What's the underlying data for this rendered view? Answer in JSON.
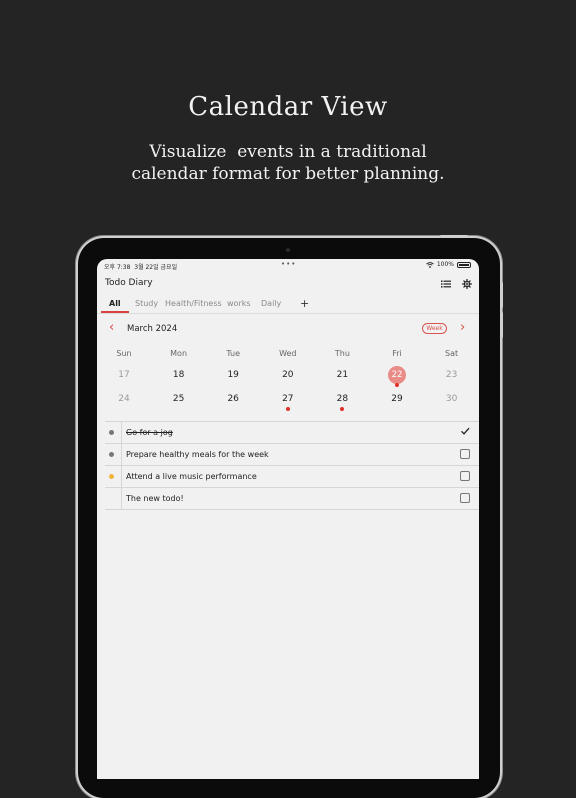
{
  "promo": {
    "title": "Calendar View",
    "subtitle_line1": "Visualize  events in a traditional",
    "subtitle_line2": "calendar format for better planning."
  },
  "status_bar": {
    "time": "오후 7:38",
    "date": "3월 22일 금요일",
    "dots": "•••",
    "battery": "100%"
  },
  "app": {
    "title": "Todo Diary",
    "list_icon": "list-icon",
    "settings_icon": "gear-icon"
  },
  "tabs": [
    {
      "label": "All",
      "active": true
    },
    {
      "label": "Study",
      "active": false
    },
    {
      "label": "Health/Fitness",
      "active": false
    },
    {
      "label": "works",
      "active": false
    },
    {
      "label": "Daily",
      "active": false
    }
  ],
  "tab_add": "+",
  "calendar": {
    "month_label": "March 2024",
    "view_toggle": "Week",
    "prev_icon": "‹",
    "next_icon": "›",
    "weekdays": [
      "Sun",
      "Mon",
      "Tue",
      "Wed",
      "Thu",
      "Fri",
      "Sat"
    ],
    "week1": [
      "17",
      "18",
      "19",
      "20",
      "21",
      "22",
      "23"
    ],
    "week2": [
      "24",
      "25",
      "26",
      "27",
      "28",
      "29",
      "30"
    ],
    "selected_day": "22",
    "days_with_events": [
      "22",
      "27",
      "28"
    ],
    "accent_color": "#d9423c",
    "selected_color": "#e98b86"
  },
  "todos": [
    {
      "text": "Go for a jog",
      "done": true,
      "bullet_color": "#777777"
    },
    {
      "text": "Prepare healthy meals for the week",
      "done": false,
      "bullet_color": "#777777"
    },
    {
      "text": "Attend a live music performance",
      "done": false,
      "bullet_color": "#f0b63a"
    },
    {
      "text": "The new todo!",
      "done": false,
      "bullet_color": ""
    }
  ]
}
